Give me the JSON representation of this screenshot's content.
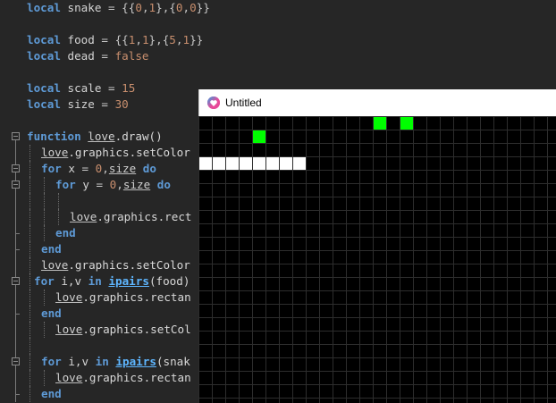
{
  "editor": {
    "lines": [
      {
        "tokens": [
          [
            "kw",
            "local"
          ],
          [
            "id",
            " snake "
          ],
          [
            "op",
            "= {{"
          ],
          [
            "num",
            "0"
          ],
          [
            "op",
            ","
          ],
          [
            "num",
            "1"
          ],
          [
            "op",
            "},{"
          ],
          [
            "num",
            "0"
          ],
          [
            "op",
            ","
          ],
          [
            "num",
            "0"
          ],
          [
            "op",
            "}}"
          ]
        ]
      },
      {
        "tokens": []
      },
      {
        "tokens": [
          [
            "kw",
            "local"
          ],
          [
            "id",
            " food "
          ],
          [
            "op",
            "= {{"
          ],
          [
            "num",
            "1"
          ],
          [
            "op",
            ","
          ],
          [
            "num",
            "1"
          ],
          [
            "op",
            "},{"
          ],
          [
            "num",
            "5"
          ],
          [
            "op",
            ","
          ],
          [
            "num",
            "1"
          ],
          [
            "op",
            "}}"
          ]
        ]
      },
      {
        "tokens": [
          [
            "kw",
            "local"
          ],
          [
            "id",
            " dead "
          ],
          [
            "op",
            "= "
          ],
          [
            "bool",
            "false"
          ]
        ]
      },
      {
        "tokens": []
      },
      {
        "tokens": [
          [
            "kw",
            "local"
          ],
          [
            "id",
            " scale "
          ],
          [
            "op",
            "= "
          ],
          [
            "num",
            "15"
          ]
        ]
      },
      {
        "tokens": [
          [
            "kw",
            "local"
          ],
          [
            "id",
            " size "
          ],
          [
            "op",
            "= "
          ],
          [
            "num",
            "30"
          ]
        ]
      },
      {
        "tokens": []
      },
      {
        "tokens": [
          [
            "kw",
            "function"
          ],
          [
            "id",
            " "
          ],
          [
            "ul",
            "love"
          ],
          [
            "fn",
            ".draw()"
          ]
        ]
      },
      {
        "tokens": [
          [
            "ul",
            "love"
          ],
          [
            "fn",
            ".graphics.setColor"
          ]
        ]
      },
      {
        "tokens": [
          [
            "kw",
            "for"
          ],
          [
            "id",
            " x "
          ],
          [
            "op",
            "= "
          ],
          [
            "num",
            "0"
          ],
          [
            "op",
            ","
          ],
          [
            "ul",
            "size"
          ],
          [
            "id",
            " "
          ],
          [
            "kw",
            "do"
          ]
        ]
      },
      {
        "tokens": [
          [
            "kw",
            "for"
          ],
          [
            "id",
            " y "
          ],
          [
            "op",
            "= "
          ],
          [
            "num",
            "0"
          ],
          [
            "op",
            ","
          ],
          [
            "ul",
            "size"
          ],
          [
            "id",
            " "
          ],
          [
            "kw",
            "do"
          ]
        ]
      },
      {
        "tokens": []
      },
      {
        "tokens": [
          [
            "ul",
            "love"
          ],
          [
            "fn",
            ".graphics.rect"
          ]
        ]
      },
      {
        "tokens": [
          [
            "kw",
            "end"
          ]
        ]
      },
      {
        "tokens": [
          [
            "kw",
            "end"
          ]
        ]
      },
      {
        "tokens": [
          [
            "ul",
            "love"
          ],
          [
            "fn",
            ".graphics.setColor"
          ]
        ]
      },
      {
        "tokens": [
          [
            "kw",
            "for"
          ],
          [
            "id",
            " i,v "
          ],
          [
            "kw",
            "in"
          ],
          [
            "id",
            " "
          ],
          [
            "lib",
            "ipairs"
          ],
          [
            "fn",
            "(food)"
          ]
        ]
      },
      {
        "tokens": [
          [
            "ul",
            "love"
          ],
          [
            "fn",
            ".graphics.rectan"
          ]
        ]
      },
      {
        "tokens": [
          [
            "kw",
            "end"
          ]
        ]
      },
      {
        "tokens": [
          [
            "ul",
            "love"
          ],
          [
            "fn",
            ".graphics.setCol"
          ]
        ]
      },
      {
        "tokens": []
      },
      {
        "tokens": [
          [
            "kw",
            "for"
          ],
          [
            "id",
            " i,v "
          ],
          [
            "kw",
            "in"
          ],
          [
            "id",
            " "
          ],
          [
            "lib",
            "ipairs"
          ],
          [
            "fn",
            "(snak"
          ]
        ]
      },
      {
        "tokens": [
          [
            "ul",
            "love"
          ],
          [
            "fn",
            ".graphics.rectan"
          ]
        ]
      },
      {
        "tokens": [
          [
            "kw",
            "end"
          ]
        ]
      }
    ]
  },
  "window": {
    "title": "Untitled",
    "icon": "love2d-heart-icon"
  },
  "game": {
    "background": "#000000",
    "grid_color": "#2d2d2d",
    "food_color": "#00ff00",
    "snake_color": "#ffffff",
    "food_cells": [
      [
        4,
        0
      ],
      [
        13,
        -1
      ],
      [
        15,
        -1
      ]
    ],
    "snake_cells": [
      [
        0,
        2
      ],
      [
        1,
        2
      ],
      [
        2,
        2
      ],
      [
        3,
        2
      ],
      [
        4,
        2
      ],
      [
        5,
        2
      ],
      [
        6,
        2
      ],
      [
        7,
        2
      ]
    ]
  }
}
